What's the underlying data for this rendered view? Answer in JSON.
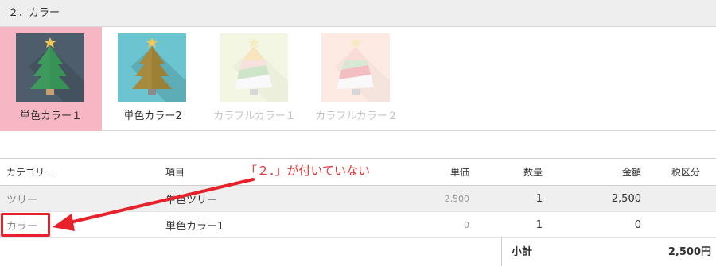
{
  "section": {
    "title": "２．カラー"
  },
  "swatches": [
    {
      "label": "単色カラー１",
      "state": "selected",
      "thumb_bg": "#4e5d6c",
      "tree_color": "#3e9a5c"
    },
    {
      "label": "単色カラー2",
      "state": "normal",
      "thumb_bg": "#6cc4d0",
      "tree_color": "#a78a3d"
    },
    {
      "label": "カラフルカラー１",
      "state": "disabled",
      "thumb_bg": "#e9f0cc",
      "tree_color": "#d6c98a"
    },
    {
      "label": "カラフルカラー２",
      "state": "disabled",
      "thumb_bg": "#fbd9cd",
      "tree_color": "#e8a5a0"
    }
  ],
  "table": {
    "headers": {
      "category": "カテゴリー",
      "item": "項目",
      "unit_price": "単価",
      "quantity": "数量",
      "amount": "金額",
      "tax": "税区分"
    },
    "rows": [
      {
        "category": "ツリー",
        "item": "単色ツリー",
        "unit_price": "2,500",
        "quantity": "1",
        "amount": "2,500"
      },
      {
        "category": "カラー",
        "item": "単色カラー1",
        "unit_price": "0",
        "quantity": "1",
        "amount": "0"
      }
    ],
    "subtotal": {
      "label": "小計",
      "value": "2,500円"
    }
  },
  "annotation": {
    "text": "「２．」が付いていない",
    "color": "#e53030"
  }
}
